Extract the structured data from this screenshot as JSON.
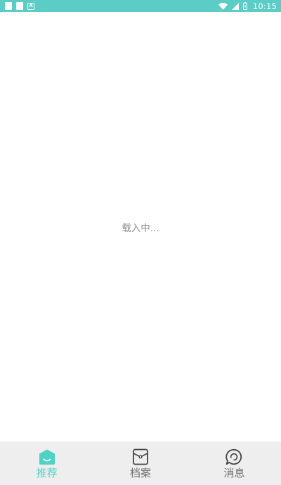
{
  "status_bar": {
    "time": "10:15",
    "left_icons": [
      "notification-card-icon",
      "notification-card-icon",
      "notification-a-icon"
    ],
    "notification_a_glyph": "A",
    "right_icons": [
      "wifi-icon",
      "signal-icon",
      "battery-icon"
    ],
    "background": "#5ccdc6"
  },
  "main": {
    "loading_text": "载入中..."
  },
  "bottom_nav": {
    "items": [
      {
        "label": "推荐",
        "icon": "home-smile-icon",
        "active": true
      },
      {
        "label": "档案",
        "icon": "archive-icon",
        "active": false
      },
      {
        "label": "消息",
        "icon": "message-bubble-icon",
        "active": false
      }
    ],
    "active_color": "#4fd1c5",
    "inactive_color": "#6e6e6e",
    "background": "#eeeeee"
  }
}
